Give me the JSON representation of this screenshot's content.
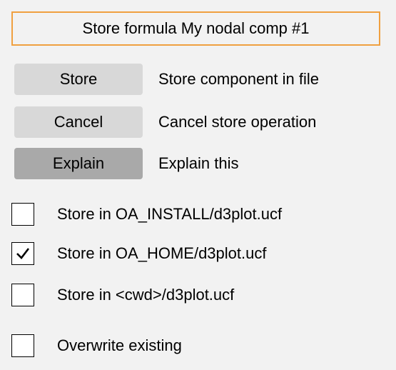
{
  "title": "Store formula My nodal comp #1",
  "buttons": [
    {
      "label": "Store",
      "description": "Store component in file"
    },
    {
      "label": "Cancel",
      "description": "Cancel store operation"
    },
    {
      "label": "Explain",
      "description": "Explain this"
    }
  ],
  "options": [
    {
      "label": "Store in OA_INSTALL/d3plot.ucf",
      "checked": false
    },
    {
      "label": "Store in OA_HOME/d3plot.ucf",
      "checked": true
    },
    {
      "label": "Store in <cwd>/d3plot.ucf",
      "checked": false
    },
    {
      "label": "Overwrite existing",
      "checked": false
    }
  ],
  "colors": {
    "title_border": "#f0a040",
    "button_bg": "#d8d8d8",
    "explain_button_bg": "#a9a9a9",
    "background": "#f2f2f2"
  },
  "icons": {
    "checked": "checkmark-icon"
  }
}
